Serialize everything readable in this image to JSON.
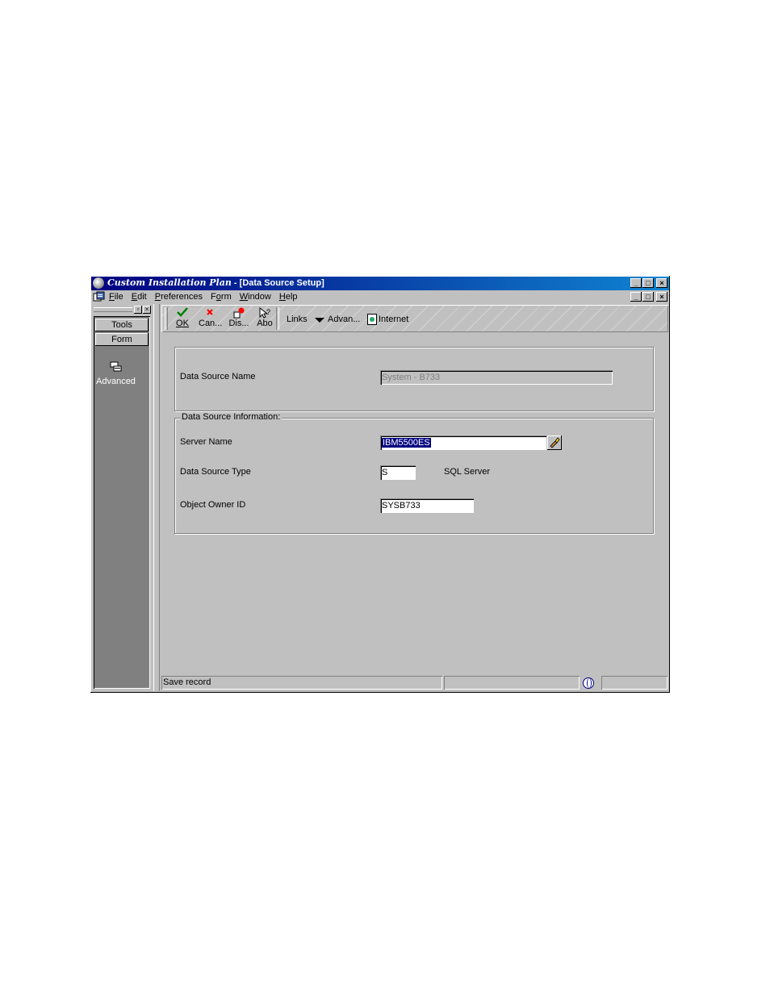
{
  "window": {
    "app_title": "Custom Installation Plan",
    "doc_title": " - [Data Source Setup]",
    "caption_buttons": [
      "_",
      "□",
      "×"
    ]
  },
  "menubar": {
    "items": [
      "File",
      "Edit",
      "Preferences",
      "Form",
      "Window",
      "Help"
    ],
    "underline_indexes": [
      0,
      0,
      0,
      1,
      0,
      0
    ],
    "mdi_buttons": [
      "_",
      "□",
      "×"
    ]
  },
  "left_panel": {
    "caption_buttons": [
      "▫",
      "×"
    ],
    "tabs": [
      "Tools",
      "Form"
    ],
    "advanced_label": "Advanced"
  },
  "toolbar": {
    "ok_label": "OK",
    "cancel_label": "Can...",
    "display_label": "Dis...",
    "about_label": "Abo",
    "links_label": "Links",
    "advanced_label": "Advan...",
    "internet_label": "Internet",
    "icons": [
      "checkmark-icon",
      "red-x-icon",
      "display-errors-icon",
      "about-help-icon"
    ],
    "icon_colors": {
      "ok": "#008000",
      "cancel": "#ff0000",
      "display": "#ff0000"
    }
  },
  "form": {
    "data_source_name_label": "Data Source Name",
    "data_source_name_value": "System - B733",
    "group_title": "Data Source Information:",
    "server_name_label": "Server Name",
    "server_name_value": "IBM5500ES",
    "data_source_type_label": "Data Source Type",
    "data_source_type_value": "S",
    "data_source_type_desc": "SQL Server",
    "object_owner_label": "Object Owner ID",
    "object_owner_value": "SYSB733"
  },
  "statusbar": {
    "message": "Save record"
  },
  "colors": {
    "title_start": "#000080",
    "title_end": "#1084d0",
    "face": "#c0c0c0",
    "selection": "#000080"
  }
}
